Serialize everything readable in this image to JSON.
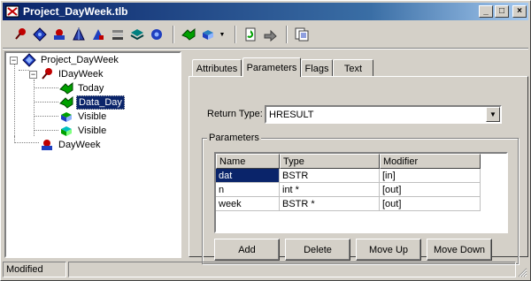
{
  "window": {
    "title": "Project_DayWeek.tlb",
    "minimize_glyph": "_",
    "maximize_glyph": "□",
    "close_glyph": "×"
  },
  "toolbar": {
    "icons": [
      "pin-icon",
      "diamond-icon",
      "struct-icon",
      "pyramid-icon",
      "module-icon",
      "stack-icon",
      "layers-icon",
      "coclass-icon",
      "new-method-icon",
      "property-icon",
      "refresh-icon",
      "export-icon",
      "view-source-icon"
    ],
    "drop_glyph": "▼"
  },
  "tree": {
    "root": "Project_DayWeek",
    "interface": "IDayWeek",
    "members": [
      "Today",
      "Data_Day",
      "Visible",
      "Visible"
    ],
    "selected_member": "Data_Day",
    "coclass": "DayWeek",
    "collapse_glyph": "−"
  },
  "tabs": [
    {
      "label": "Attributes"
    },
    {
      "label": "Parameters"
    },
    {
      "label": "Flags"
    },
    {
      "label": "Text"
    }
  ],
  "active_tab": "Parameters",
  "return_type": {
    "label": "Return Type:",
    "value": "HRESULT",
    "drop_glyph": "▼"
  },
  "parameters": {
    "group_label": "Parameters",
    "columns": [
      "Name",
      "Type",
      "Modifier"
    ],
    "rows": [
      {
        "name": "dat",
        "type": "BSTR",
        "modifier": "[in]"
      },
      {
        "name": "n",
        "type": "int *",
        "modifier": "[out]"
      },
      {
        "name": "week",
        "type": "BSTR *",
        "modifier": "[out]"
      }
    ],
    "buttons": {
      "add": "Add",
      "delete": "Delete",
      "move_up": "Move Up",
      "move_down": "Move Down"
    }
  },
  "status": {
    "text": "Modified"
  },
  "colors": {
    "titlebar_start": "#0a246a",
    "titlebar_end": "#a6caf0",
    "face": "#d4d0c8",
    "selection": "#0a246a"
  }
}
